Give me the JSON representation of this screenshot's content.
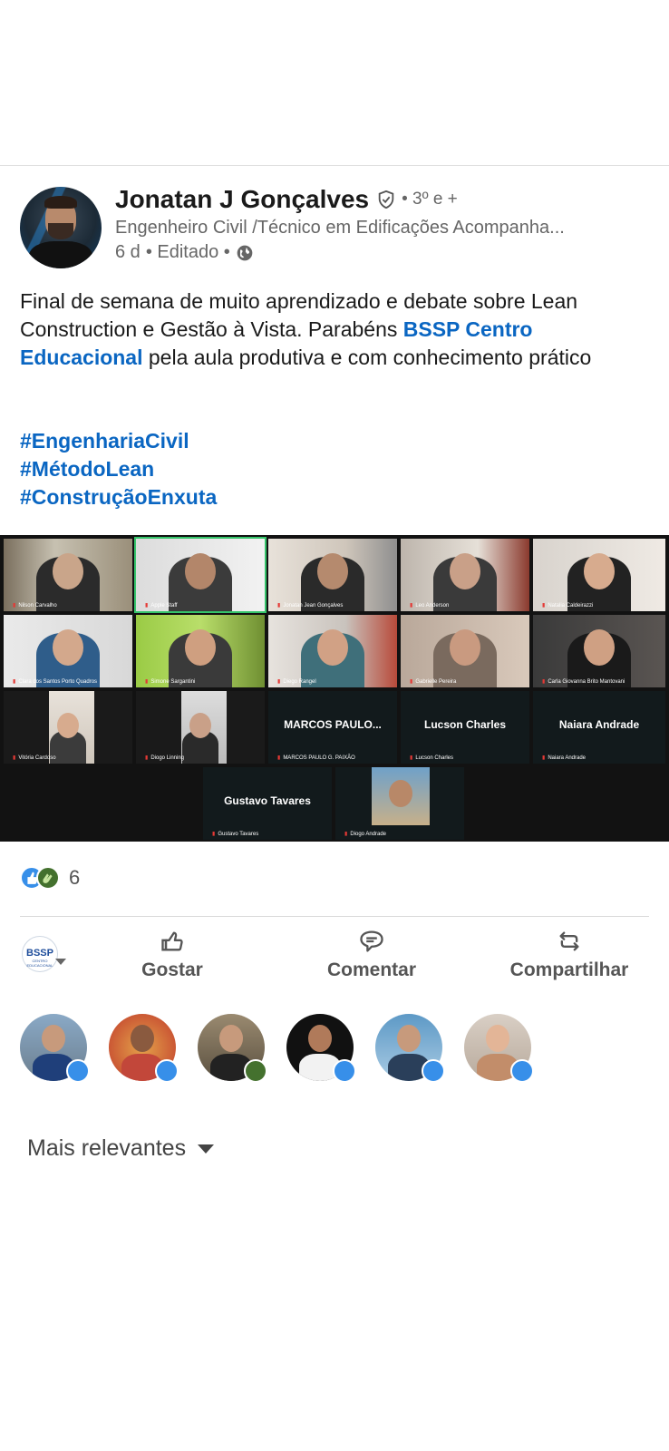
{
  "post": {
    "author": "Jonatan J Gonçalves",
    "degree": "• 3º e +",
    "headline": "Engenheiro Civil /Técnico em Edificações Acompanha...",
    "time": "6 d",
    "edited": "• Editado •",
    "body_part1": "Final de semana de muito aprendizado e debate sobre Lean Construction  e Gestão à Vista. Parabéns ",
    "mention": "BSSP Centro Educacional",
    "body_part2": "  pela aula produtiva e com conhecimento  prático",
    "hashtags": [
      "#EngenhariaCivil",
      "#MétodoLean",
      "#ConstruçãoEnxuta"
    ]
  },
  "zoom": {
    "participants": [
      "Nilson Carvalho",
      "Apple Staff",
      "Jonatan Jean Gonçalves",
      "Leo Anderson",
      "Natalia Caldeirazzi",
      "Clara dos Santos Porto Quadros",
      "Simone Sargantini",
      "Diego Rangel",
      "Gabrielle Pereira",
      "Carla Giovanna Brito Mantovani",
      "Vitória Cardoso",
      "Diogo Linning",
      "MARCOS PAULO G. PAIXÃO",
      "Lucson Charles",
      "Naiara Andrade",
      "Gustavo Tavares",
      "Diogo Andrade"
    ],
    "big_names": [
      "MARCOS  PAULO...",
      "Lucson Charles",
      "Naiara Andrade",
      "Gustavo Tavares"
    ]
  },
  "reactions": {
    "count": "6",
    "types": [
      "like-icon",
      "clap-icon"
    ]
  },
  "company": {
    "logo_text": "BSSP",
    "logo_sub": "CENTRO EDUCACIONAL"
  },
  "actions": {
    "like": "Gostar",
    "comment": "Comentar",
    "share": "Compartilhar"
  },
  "reactors": [
    {
      "badge": "like"
    },
    {
      "badge": "like"
    },
    {
      "badge": "clap"
    },
    {
      "badge": "like"
    },
    {
      "badge": "like"
    },
    {
      "badge": "like"
    }
  ],
  "sort": {
    "label": "Mais relevantes"
  },
  "colors": {
    "link": "#0a66c2",
    "like": "#378fe9",
    "clap": "#44712e",
    "text_muted": "#666666"
  }
}
